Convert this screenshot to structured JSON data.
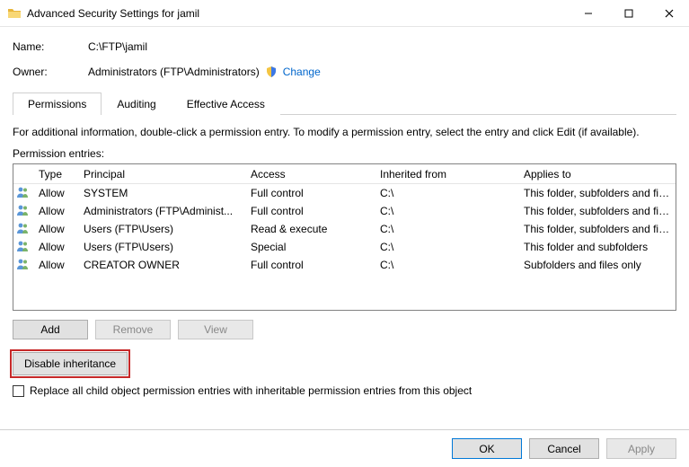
{
  "window": {
    "title": "Advanced Security Settings for jamil"
  },
  "fields": {
    "name_label": "Name:",
    "name_value": "C:\\FTP\\jamil",
    "owner_label": "Owner:",
    "owner_value": "Administrators (FTP\\Administrators)",
    "change_link": "Change"
  },
  "tabs": {
    "permissions": "Permissions",
    "auditing": "Auditing",
    "effective": "Effective Access"
  },
  "info_text": "For additional information, double-click a permission entry. To modify a permission entry, select the entry and click Edit (if available).",
  "entries_label": "Permission entries:",
  "headers": {
    "type": "Type",
    "principal": "Principal",
    "access": "Access",
    "inherited": "Inherited from",
    "applies": "Applies to"
  },
  "rows": [
    {
      "type": "Allow",
      "principal": "SYSTEM",
      "access": "Full control",
      "inherited": "C:\\",
      "applies": "This folder, subfolders and files"
    },
    {
      "type": "Allow",
      "principal": "Administrators (FTP\\Administ...",
      "access": "Full control",
      "inherited": "C:\\",
      "applies": "This folder, subfolders and files"
    },
    {
      "type": "Allow",
      "principal": "Users (FTP\\Users)",
      "access": "Read & execute",
      "inherited": "C:\\",
      "applies": "This folder, subfolders and files"
    },
    {
      "type": "Allow",
      "principal": "Users (FTP\\Users)",
      "access": "Special",
      "inherited": "C:\\",
      "applies": "This folder and subfolders"
    },
    {
      "type": "Allow",
      "principal": "CREATOR OWNER",
      "access": "Full control",
      "inherited": "C:\\",
      "applies": "Subfolders and files only"
    }
  ],
  "buttons": {
    "add": "Add",
    "remove": "Remove",
    "view": "View",
    "disable_inheritance": "Disable inheritance",
    "ok": "OK",
    "cancel": "Cancel",
    "apply": "Apply"
  },
  "checkbox_label": "Replace all child object permission entries with inheritable permission entries from this object"
}
